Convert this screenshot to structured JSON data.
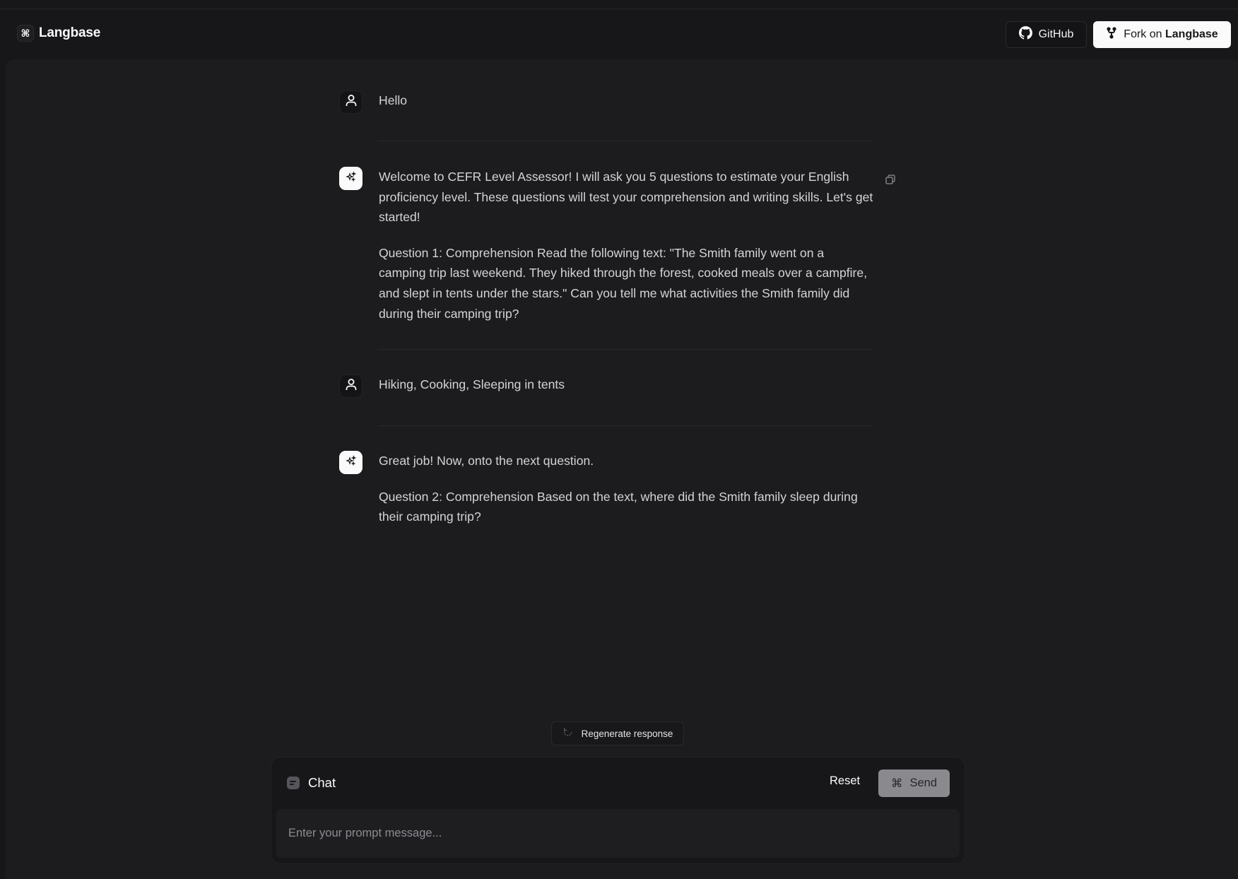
{
  "header": {
    "logo_symbol": "⌘",
    "app_name": "Langbase",
    "github_label": "GitHub",
    "fork_prefix": "Fork on",
    "fork_brand": "Langbase"
  },
  "icons": {
    "logo": "command-icon",
    "github": "github-icon",
    "fork": "git-fork-icon",
    "user_avatar": "user-icon",
    "bot_avatar": "sparkles-icon",
    "copy": "copy-icon",
    "regenerate": "refresh-icon",
    "chat": "chat-bubble-icon",
    "send": "command-icon"
  },
  "messages": [
    {
      "role": "user",
      "paragraphs": [
        "Hello"
      ]
    },
    {
      "role": "assistant",
      "paragraphs": [
        "Welcome to CEFR Level Assessor! I will ask you 5 questions to estimate your English proficiency level. These questions will test your comprehension and writing skills. Let's get started!",
        "Question 1: Comprehension Read the following text: \"The Smith family went on a camping trip last weekend. They hiked through the forest, cooked meals over a campfire, and slept in tents under the stars.\" Can you tell me what activities the Smith family did during their camping trip?"
      ]
    },
    {
      "role": "user",
      "paragraphs": [
        "Hiking, Cooking, Sleeping in tents"
      ]
    },
    {
      "role": "assistant",
      "paragraphs": [
        "Great job! Now, onto the next question.",
        "Question 2: Comprehension Based on the text, where did the Smith family sleep during their camping trip?"
      ]
    }
  ],
  "regenerate_label": "Regenerate response",
  "chat": {
    "title": "Chat",
    "reset_label": "Reset",
    "send_symbol": "⌘",
    "send_label": "Send",
    "input_value": "",
    "input_placeholder": "Enter your prompt message..."
  },
  "colors": {
    "background": "#17171a",
    "panel": "#1c1c1f",
    "primary_button": "#fafafa",
    "send_button_disabled": "#8a8a8e"
  }
}
